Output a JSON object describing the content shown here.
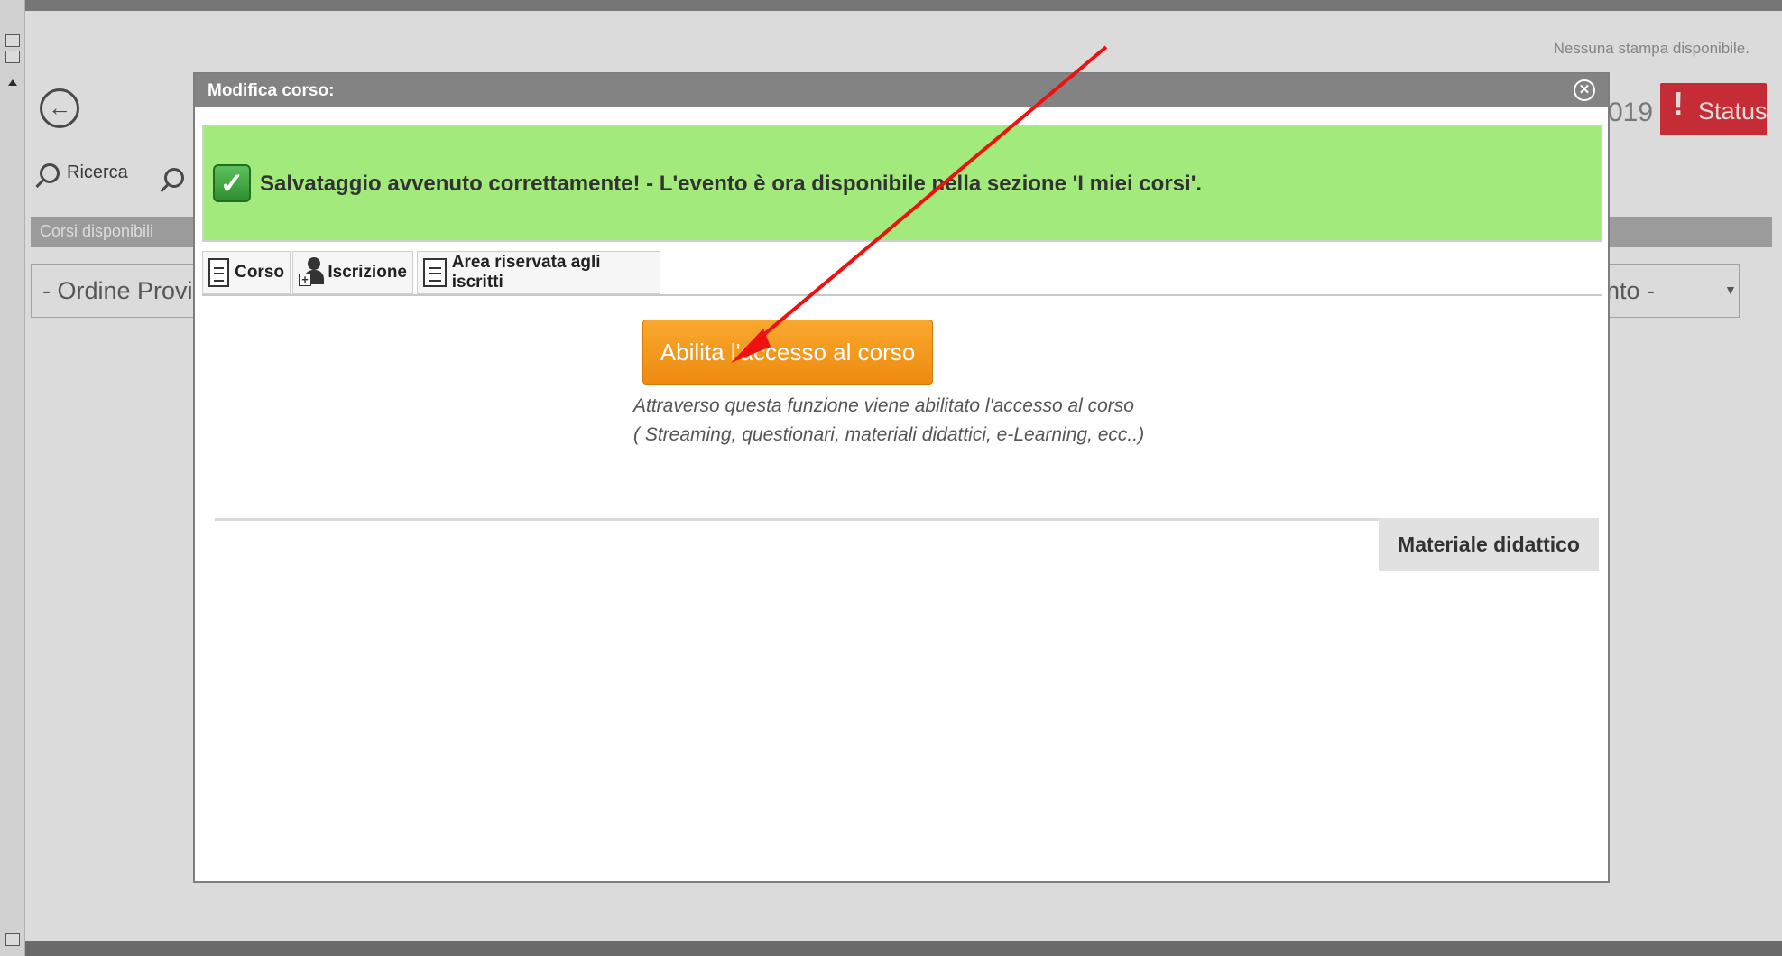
{
  "background": {
    "no_print_text": "Nessuna stampa disponibile.",
    "year_fragment": "019",
    "status_label": "Status",
    "search_label": "Ricerca",
    "tab_label": "Corsi disponibili",
    "filter_left": "- Ordine Provin",
    "filter_right": "nto -"
  },
  "modal": {
    "title": "Modifica corso:",
    "close_symbol": "✕",
    "success_message": "Salvataggio avvenuto correttamente! - L'evento è ora disponibile nella sezione 'I miei corsi'.",
    "tabs": [
      {
        "label": "Corso",
        "icon": "document-icon"
      },
      {
        "label": "Iscrizione",
        "icon": "user-add-icon"
      },
      {
        "label": "Area riservata agli iscritti",
        "icon": "document-icon"
      }
    ],
    "enable_button": "Abilita l'accesso al corso",
    "description_line1": "Attraverso questa funzione viene abilitato l'accesso al corso",
    "description_line2": "( Streaming, questionari, materiali didattici, e-Learning, ecc..)",
    "material_button": "Materiale didattico"
  },
  "colors": {
    "success": "#a3ea7c",
    "orange_button": "#f39a1f",
    "status_red": "#e7343f",
    "arrow": "#ee1111"
  }
}
